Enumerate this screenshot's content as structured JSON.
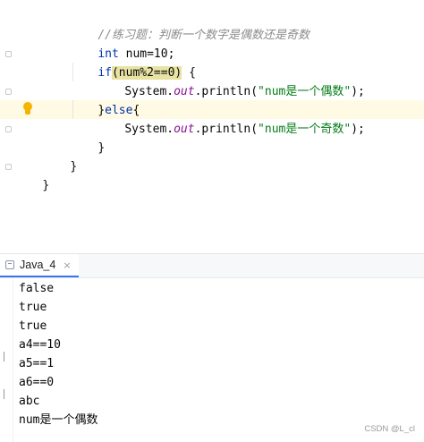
{
  "editor": {
    "comment": "//练习题：判断一个数字是偶数还是奇数",
    "line2": {
      "kw": "int",
      "rest": " num=10;"
    },
    "line3": {
      "kw": "if",
      "open": "(",
      "cond": "num%2==0",
      "close": ") {"
    },
    "line4": {
      "obj": "System.",
      "field": "out",
      "call": ".println(",
      "str": "\"num是一个偶数\"",
      "end": ");"
    },
    "line5": {
      "brace": "}",
      "kw": "else",
      "rest": "{"
    },
    "line6": {
      "obj": "System.",
      "field": "out",
      "call": ".println(",
      "str": "\"num是一个奇数\"",
      "end": ");"
    },
    "line7": "}",
    "line8": "}",
    "line9": "}"
  },
  "run_panel": {
    "tab_label": "Java_4",
    "tab_close": "×",
    "output": [
      "false",
      "true",
      "true",
      "a4==10",
      "a5==1",
      "a6==0",
      "abc",
      "num是一个偶数"
    ]
  },
  "watermark": "CSDN @L_cl",
  "icons": {
    "intention": "lightbulb-icon",
    "tab": "console-icon",
    "close": "close-icon"
  },
  "colors": {
    "keyword": "#0033b3",
    "string": "#067d17",
    "field": "#871094",
    "comment": "#8c8c8c",
    "current_line": "#fffae3",
    "match_highlight": "#e8e3a3"
  }
}
